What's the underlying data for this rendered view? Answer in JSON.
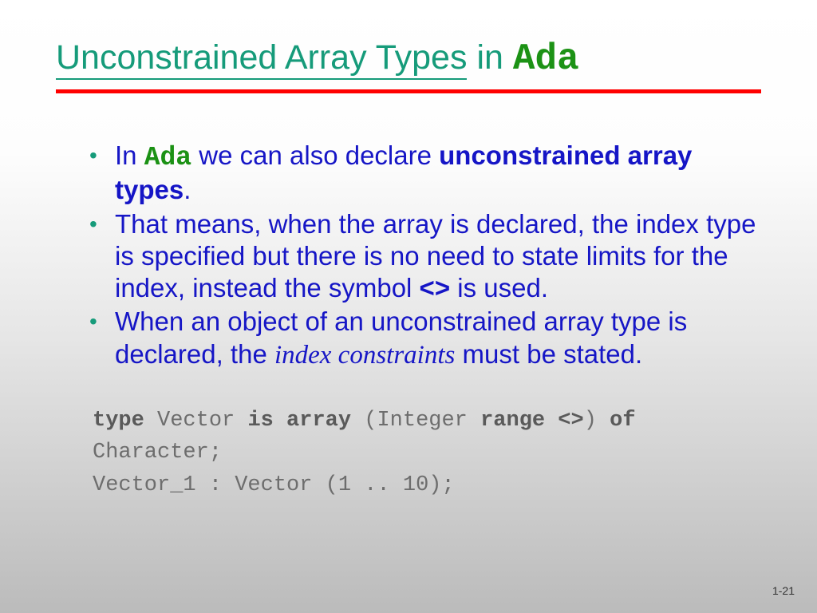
{
  "title": {
    "main": "Unconstrained Array Types",
    "in": "in",
    "ada": "Ada"
  },
  "bullets": {
    "b1": {
      "pre": "In ",
      "ada": "Ada",
      "mid": " we can also declare ",
      "bold": "unconstrained array types",
      "end": "."
    },
    "b2": {
      "pre": "That means, when the array is declared, the index type is specified but there is no need to state limits for the index, instead the symbol ",
      "sym": "<>",
      "end": " is used."
    },
    "b3": {
      "pre": "When an object of an unconstrained array type is declared, the ",
      "it": "index constraints",
      "end": " must be stated."
    }
  },
  "code": {
    "l1": {
      "k1": "type",
      "t1": " Vector ",
      "k2": "is array",
      "t2": " (Integer ",
      "k3": "range <>",
      "t3": ") ",
      "k4": "of",
      "t4": " Character;"
    },
    "l2": "Vector_1 : Vector (1 .. 10);"
  },
  "pagenum": "1-21"
}
